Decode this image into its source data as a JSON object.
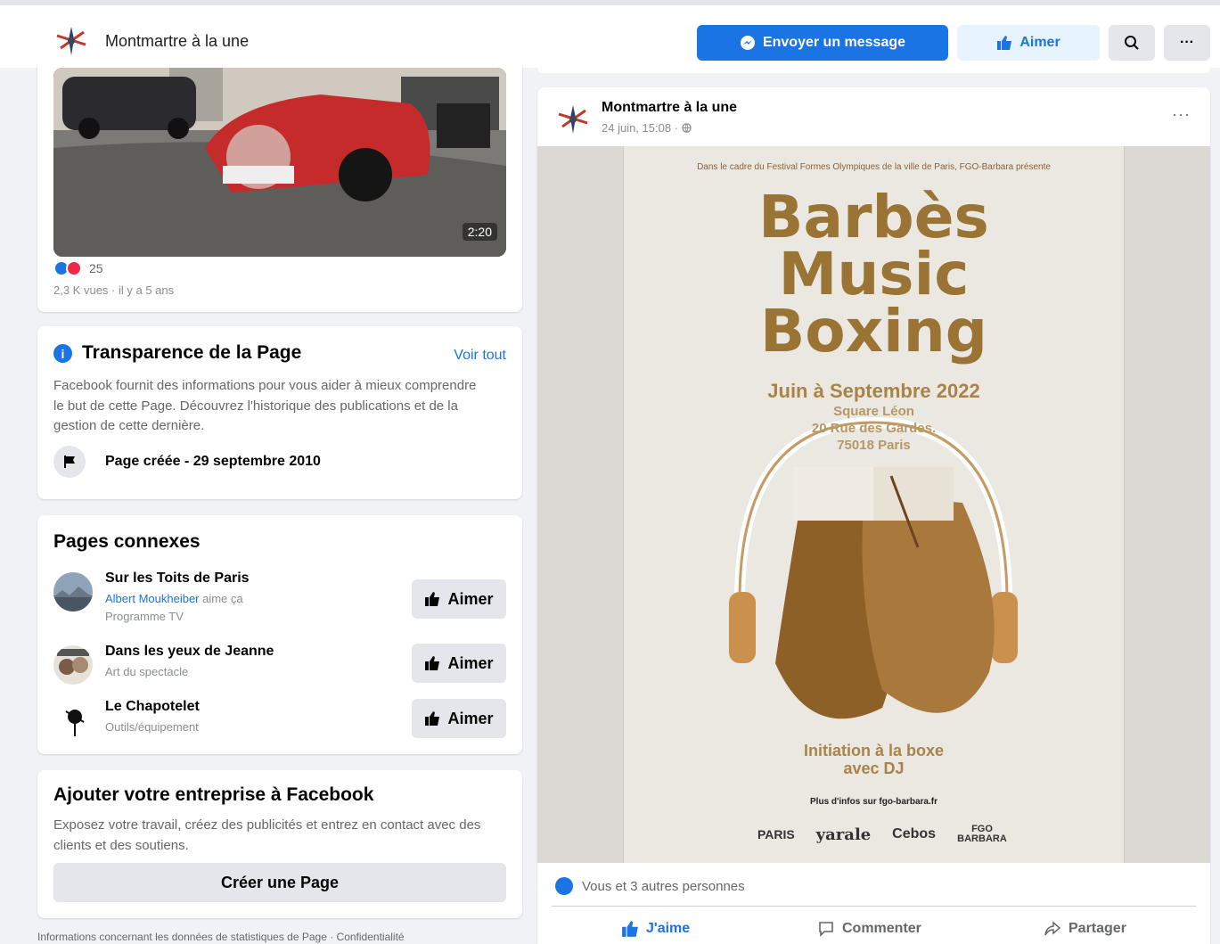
{
  "header": {
    "page_name": "Montmartre à la une",
    "message_label": "Envoyer un message",
    "like_label": "Aimer",
    "more_label": "···"
  },
  "video_card": {
    "duration": "2:20",
    "reaction_count": "25",
    "meta": "2,3 K vues · il y a 5 ans"
  },
  "transparency": {
    "title": "Transparence de la Page",
    "see_all": "Voir tout",
    "description": "Facebook fournit des informations pour vous aider à mieux comprendre le but de cette Page. Découvrez l'historique des publications et de la gestion de cette dernière.",
    "created": "Page créée - 29 septembre 2010"
  },
  "related_pages": {
    "title": "Pages connexes",
    "like_label": "Aimer",
    "items": [
      {
        "name": "Sur les Toits de Paris",
        "liker": "Albert Moukheiber",
        "liker_suffix": " aime ça",
        "category": "Programme TV"
      },
      {
        "name": "Dans les yeux de Jeanne",
        "category": "Art du spectacle"
      },
      {
        "name": "Le Chapotelet",
        "category": "Outils/équipement"
      }
    ]
  },
  "business": {
    "title": "Ajouter votre entreprise à Facebook",
    "description": "Exposez votre travail, créez des publicités et entrez en contact avec des clients et des soutiens.",
    "create_label": "Créer une Page"
  },
  "footer": {
    "text": "Informations concernant les données de statistiques de Page · Confidentialité"
  },
  "post": {
    "author": "Montmartre à la une",
    "date": "24 juin, 15:08 · ",
    "more": "···",
    "poster": {
      "intro": "Dans le cadre du Festival Formes Olympiques de la ville de Paris, FGO-Barbara présente",
      "title_line1": "Barbès",
      "title_line2": "Music",
      "title_line3": "Boxing",
      "dates": "Juin à Septembre 2022",
      "address_line1": "Square Léon",
      "address_line2": "20 Rue des Gardes.",
      "address_line3": "75018 Paris",
      "initiation_line1": "Initiation à la boxe",
      "initiation_line2": "avec DJ",
      "info": "Plus d'infos sur fgo-barbara.fr",
      "logo1": "PARIS",
      "logo2": "yarale",
      "logo3": "Cebos",
      "logo4": "FGO BARBARA"
    },
    "likes_text": "Vous et 3 autres personnes",
    "actions": {
      "like": "J'aime",
      "comment": "Commenter",
      "share": "Partager"
    }
  },
  "colors": {
    "accent": "#1b74e4",
    "background": "#f0f2f5",
    "poster_gold": "#9a7434"
  }
}
